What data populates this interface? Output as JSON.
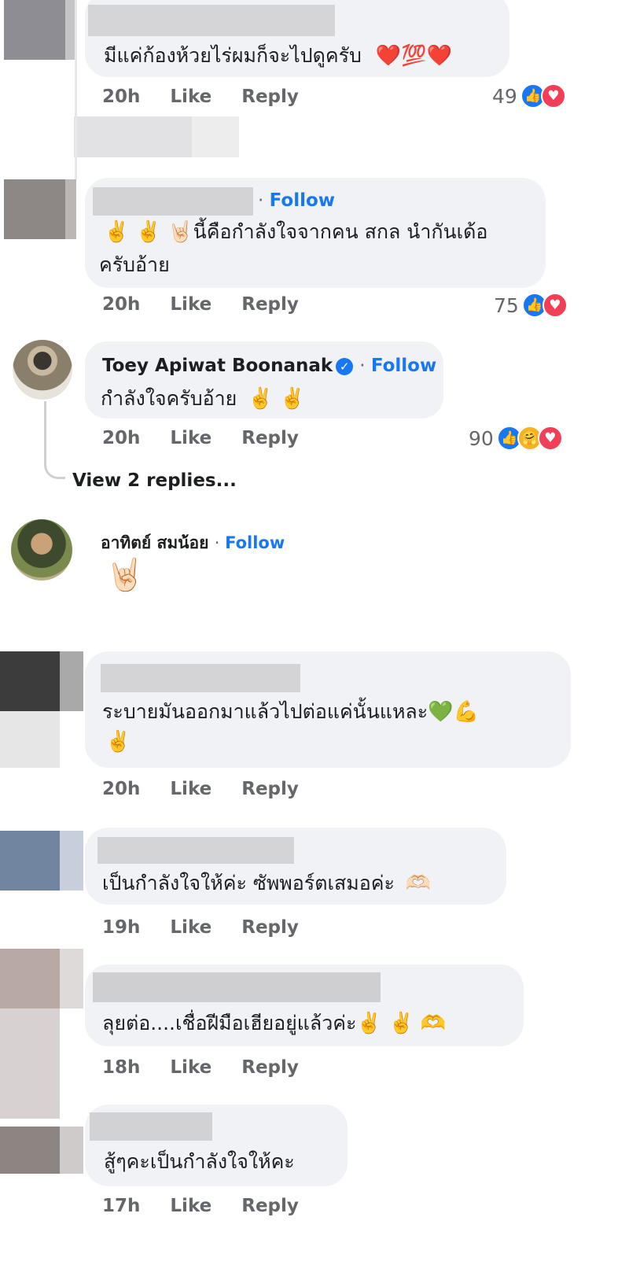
{
  "comments": [
    {
      "text": "มีแค่ก้องห้วยไร่ผมก็จะไปดูครับ",
      "emoji": "❤️💯❤️",
      "time": "20h",
      "like": "Like",
      "reply": "Reply",
      "reaction_count": "49"
    },
    {
      "follow": "Follow",
      "line1_emoji": "✌️ ✌️ 🤘🏻",
      "line1": "นี้คือกำลังใจจากคน สกล นำกันเด้อ",
      "line2": "ครับอ้าย",
      "time": "20h",
      "like": "Like",
      "reply": "Reply",
      "reaction_count": "75"
    },
    {
      "name": "Toey Apiwat Boonanak",
      "follow": "Follow",
      "text": "กำลังใจครับอ้าย",
      "emoji": "✌️ ✌️",
      "time": "20h",
      "like": "Like",
      "reply": "Reply",
      "reaction_count": "90",
      "view_replies": "View 2 replies..."
    },
    {
      "name": "อาทิตย์ สมน้อย",
      "follow": "Follow",
      "sticker": "🤘🏻"
    },
    {
      "text": "ระบายมันออกมาแล้วไปต่อแค่นั้นแหละ",
      "emoji_line1": "💚💪",
      "emoji_line2": "✌️",
      "time": "20h",
      "like": "Like",
      "reply": "Reply"
    },
    {
      "text": "เป็นกำลังใจให้ค่ะ ซัพพอร์ตเสมอค่ะ",
      "emoji": "🫶🏻",
      "time": "19h",
      "like": "Like",
      "reply": "Reply"
    },
    {
      "text": "ลุยต่อ....เชื่อฝีมือเฮียอยู่แล้วค่ะ",
      "emoji": "✌️ ✌️ 🫶",
      "time": "18h",
      "like": "Like",
      "reply": "Reply"
    },
    {
      "text": "สู้ๆคะเป็นกำลังใจให้คะ",
      "time": "17h",
      "like": "Like",
      "reply": "Reply"
    }
  ],
  "icons": {
    "like": "like-reaction-icon",
    "love": "love-reaction-icon",
    "care": "care-reaction-icon",
    "verified": "verified-badge-icon"
  },
  "colors": {
    "bubble": "#f0f2f5",
    "follow": "#1877f2",
    "meta": "#65676b"
  }
}
